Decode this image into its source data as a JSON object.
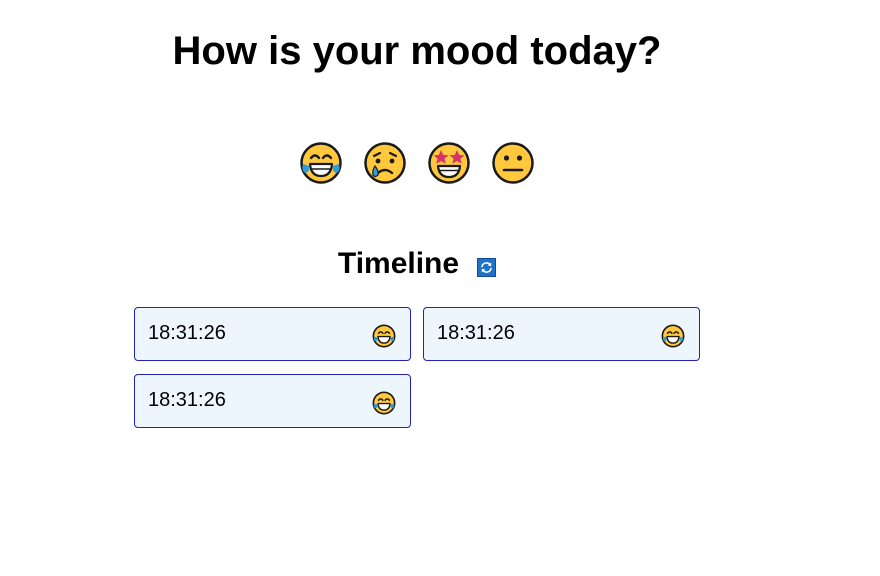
{
  "heading": "How is your mood today?",
  "moods": [
    {
      "icon": "tears-of-joy-emoji",
      "key": "joy"
    },
    {
      "icon": "crying-face-emoji",
      "key": "sad"
    },
    {
      "icon": "star-struck-emoji",
      "key": "starstruck"
    },
    {
      "icon": "neutral-face-emoji",
      "key": "neutral"
    }
  ],
  "timeline": {
    "title": "Timeline",
    "refresh_icon": "refresh-icon",
    "entries": [
      {
        "time": "18:31:26",
        "icon": "tears-of-joy-emoji"
      },
      {
        "time": "18:31:26",
        "icon": "tears-of-joy-emoji"
      },
      {
        "time": "18:31:26",
        "icon": "tears-of-joy-emoji"
      }
    ]
  },
  "colors": {
    "emoji_yellow": "#FFC83D",
    "entry_border": "#2222BB",
    "entry_bg": "#EEF6FD",
    "tear_blue": "#2E9BDB",
    "star_pink": "#D6336C"
  }
}
